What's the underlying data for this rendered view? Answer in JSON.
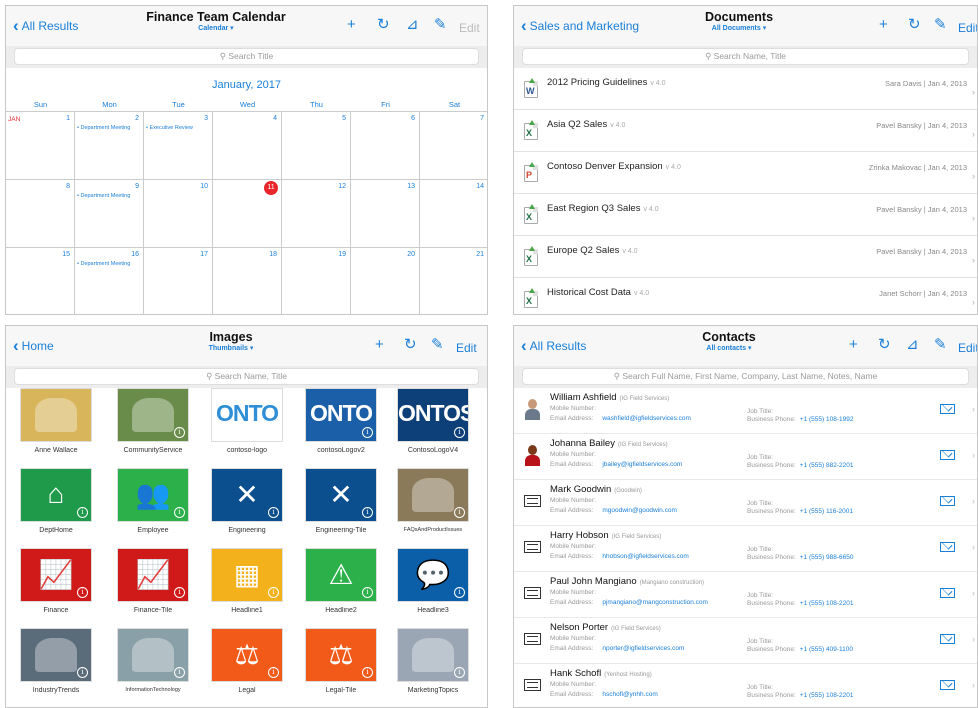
{
  "calendar": {
    "back_label": "All Results",
    "title": "Finance Team Calendar",
    "view": "Calendar ▾",
    "search_placeholder": "Search Title",
    "month": "January, 2017",
    "weekdays": [
      "Sun",
      "Mon",
      "Tue",
      "Wed",
      "Thu",
      "Fri",
      "Sat"
    ],
    "month_tag": "JAN",
    "edit_label": "Edit",
    "weeks": [
      [
        {
          "n": "1"
        },
        {
          "n": "2",
          "ev": "Department Meeting"
        },
        {
          "n": "3",
          "ev": "Executive Review"
        },
        {
          "n": "4"
        },
        {
          "n": "5"
        },
        {
          "n": "6"
        },
        {
          "n": "7"
        }
      ],
      [
        {
          "n": "8"
        },
        {
          "n": "9",
          "ev": "Department Meeting"
        },
        {
          "n": "10"
        },
        {
          "n": "11",
          "today": true
        },
        {
          "n": "12"
        },
        {
          "n": "13"
        },
        {
          "n": "14"
        }
      ],
      [
        {
          "n": "15"
        },
        {
          "n": "16",
          "ev": "Department Meeting"
        },
        {
          "n": "17"
        },
        {
          "n": "18"
        },
        {
          "n": "19"
        },
        {
          "n": "20"
        },
        {
          "n": "21"
        }
      ]
    ]
  },
  "documents": {
    "back_label": "Sales and Marketing",
    "title": "Documents",
    "view": "All Documents ▾",
    "search_placeholder": "Search Name, Title",
    "edit_label": "Edit",
    "items": [
      {
        "name": "2012 Pricing Guidelines",
        "ver": "v 4.0",
        "meta": "Sara Davis | Jan 4, 2013",
        "type": "W",
        "color": "#2b5797"
      },
      {
        "name": "Asia Q2 Sales",
        "ver": "v 4.0",
        "meta": "Pavel Bansky | Jan 4, 2013",
        "type": "X",
        "color": "#1e7145"
      },
      {
        "name": "Contoso Denver Expansion",
        "ver": "v 4.0",
        "meta": "Zrinka Makovac | Jan 4, 2013",
        "type": "P",
        "color": "#d24726"
      },
      {
        "name": "East Region Q3 Sales",
        "ver": "v 4.0",
        "meta": "Pavel Bansky | Jan 4, 2013",
        "type": "X",
        "color": "#1e7145"
      },
      {
        "name": "Europe Q2 Sales",
        "ver": "v 4.0",
        "meta": "Pavel Bansky | Jan 4, 2013",
        "type": "X",
        "color": "#1e7145"
      },
      {
        "name": "Historical Cost Data",
        "ver": "v 4.0",
        "meta": "Janet Schorr | Jan 4, 2013",
        "type": "X",
        "color": "#1e7145"
      }
    ]
  },
  "images": {
    "back_label": "Home",
    "title": "Images",
    "view": "Thumbnails ▾",
    "search_placeholder": "Search Name, Title",
    "edit_label": "Edit",
    "tiles": [
      {
        "label": "Anne Wallace",
        "kind": "photo",
        "bg": "#d8b45a"
      },
      {
        "label": "CommunityService",
        "kind": "photo",
        "bg": "#6a8c4a"
      },
      {
        "label": "contoso-logo",
        "kind": "text",
        "bg": "#ffffff",
        "fg": "#2f8fd6",
        "text": "ONTO"
      },
      {
        "label": "contosoLogov2",
        "kind": "text",
        "bg": "#1a5fa8",
        "fg": "#ffffff",
        "text": "ONTO"
      },
      {
        "label": "ContosoLogoV4",
        "kind": "text",
        "bg": "#0d3f78",
        "fg": "#ffffff",
        "text": "ONTOS"
      },
      {
        "label": "DeptHome",
        "kind": "icon",
        "bg": "#1e9a4a",
        "glyph": "⌂"
      },
      {
        "label": "Employee",
        "kind": "icon",
        "bg": "#2bb04a",
        "glyph": "👥"
      },
      {
        "label": "Engineering",
        "kind": "icon",
        "bg": "#0b4f8f",
        "glyph": "✕"
      },
      {
        "label": "Engineering-Tile",
        "kind": "icon",
        "bg": "#0b4f8f",
        "glyph": "✕"
      },
      {
        "label": "FAQsAndProductIssues",
        "kind": "photo",
        "bg": "#8a7a5a",
        "small": true
      },
      {
        "label": "Finance",
        "kind": "icon",
        "bg": "#d01a1a",
        "glyph": "📈"
      },
      {
        "label": "Finance-Tile",
        "kind": "icon",
        "bg": "#d01a1a",
        "glyph": "📈"
      },
      {
        "label": "Headline1",
        "kind": "icon",
        "bg": "#f3b21c",
        "glyph": "▦"
      },
      {
        "label": "Headline2",
        "kind": "icon",
        "bg": "#2bb04a",
        "glyph": "⚠"
      },
      {
        "label": "Headline3",
        "kind": "icon",
        "bg": "#0b5fa8",
        "glyph": "💬"
      },
      {
        "label": "IndustryTrends",
        "kind": "photo",
        "bg": "#5a6b7a"
      },
      {
        "label": "InformationTechnology",
        "kind": "photo",
        "bg": "#8aa0a8",
        "small": true
      },
      {
        "label": "Legal",
        "kind": "icon",
        "bg": "#f25a1a",
        "glyph": "⚖"
      },
      {
        "label": "Legal-Tile",
        "kind": "icon",
        "bg": "#f25a1a",
        "glyph": "⚖"
      },
      {
        "label": "MarketingTopics",
        "kind": "photo",
        "bg": "#9aa6b4"
      }
    ]
  },
  "contacts": {
    "back_label": "All Results",
    "title": "Contacts",
    "view": "All contacts ▾",
    "search_placeholder": "Search Full Name, First Name, Company, Last Name, Notes, Name",
    "edit_label": "Edit",
    "labels": {
      "mobile": "Mobile Number:",
      "email": "Email Address:",
      "job": "Job Title:",
      "phone": "Business Phone:"
    },
    "items": [
      {
        "name": "William Ashfield",
        "company": "(IG Field Services)",
        "email": "washfield@igfieldservices.com",
        "phone": "+1 (555) 108-1992",
        "avatar": "photo-m"
      },
      {
        "name": "Johanna Bailey",
        "company": "(IG Field Services)",
        "email": "jbailey@igfieldservices.com",
        "phone": "+1 (555) 882-2201",
        "avatar": "photo-f"
      },
      {
        "name": "Mark Goodwin",
        "company": "(Goodwin)",
        "email": "mgoodwin@goodwin.com",
        "phone": "+1 (555) 116-2001",
        "avatar": "card"
      },
      {
        "name": "Harry Hobson",
        "company": "(IG Field Services)",
        "email": "hhobson@igfieldservices.com",
        "phone": "+1 (555) 988-6650",
        "avatar": "card"
      },
      {
        "name": "Paul John Mangiano",
        "company": "(Mangiano construction)",
        "email": "pjmangiano@mangconstruction.com",
        "phone": "+1 (555) 108-2201",
        "avatar": "card"
      },
      {
        "name": "Nelson Porter",
        "company": "(IG Field Services)",
        "email": "nporter@igfieldservices.com",
        "phone": "+1 (555) 409-1100",
        "avatar": "card"
      },
      {
        "name": "Hank Schofl",
        "company": "(Yenhost Hosting)",
        "email": "hschofl@ynhh.com",
        "phone": "+1 (555) 108-2201",
        "avatar": "card"
      }
    ]
  }
}
